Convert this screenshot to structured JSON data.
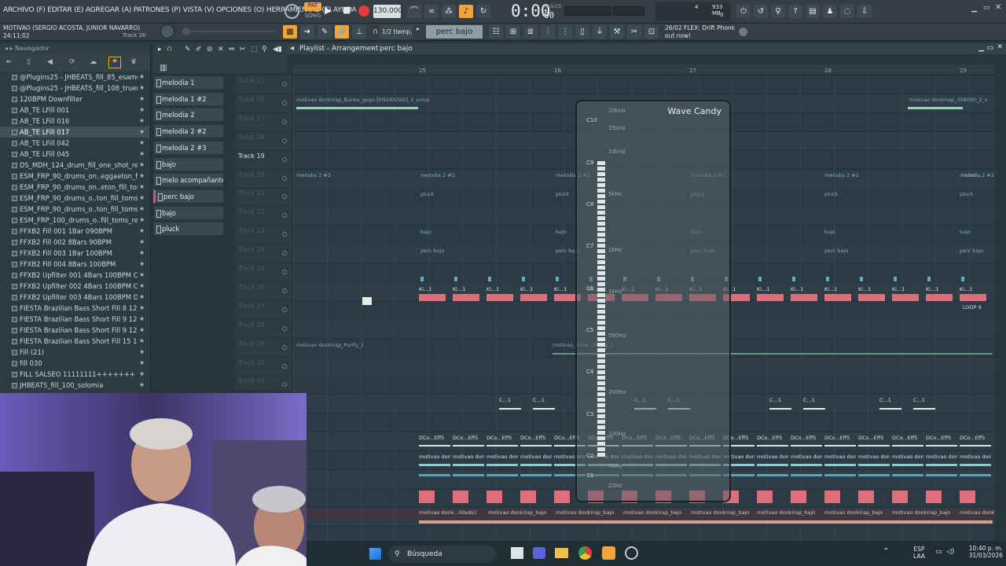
{
  "menu": "ARCHIVO (F) EDITAR (E) AGREGAR (A) PATRONES (P) VISTA (V) OPCIONES (O) HERRAMIENTAS (T) AYUDA",
  "transport": {
    "pat_label": "PAT",
    "song_label": "SONG",
    "tempo": "130.000",
    "time": "0:00",
    "time_unit": "00",
    "time_mode": "M:S:CS",
    "cpu_value": "4",
    "ram_value": "933 MB",
    "poly_value": "0"
  },
  "project": {
    "title": "MOTIVAO (SERGIO ACOSTA, JUNIOR NAVARRO)",
    "time": "24:11:02",
    "track": "Track 26"
  },
  "toolbar2": {
    "snap": "1/2 tiemp.",
    "pattern": "perc bajo",
    "news_date": "26/02",
    "news_text": "FLEX: Drift Phonk",
    "news_text2": "out now!"
  },
  "browser": {
    "title": "Navegador",
    "items": [
      {
        "label": "@Plugins25 - JHBEATS_fill_85_esamor",
        "star": "★"
      },
      {
        "label": "@Plugins25 - JHBEATS_fill_108_trueno",
        "star": "★"
      },
      {
        "label": "120BPM Downfilter",
        "star": "★"
      },
      {
        "label": "AB_TE LFill 001",
        "star": "★"
      },
      {
        "label": "AB_TE LFill 016",
        "star": "★"
      },
      {
        "label": "AB_TE LFill 017",
        "star": "★"
      },
      {
        "label": "AB_TE LFill 042",
        "star": "★"
      },
      {
        "label": "AB_TE LFill 045",
        "star": "★"
      },
      {
        "label": "DS_MDH_124_drum_fill_one_shot_reggae",
        "star": "★"
      },
      {
        "label": "ESM_FRP_90_drums_on..eggaeton_fill_swing",
        "star": "★"
      },
      {
        "label": "ESM_FRP_90_drums_on..eton_fill_toms_jack",
        "star": "★"
      },
      {
        "label": "ESM_FRP_90_drums_o..ton_fill_toms_proud",
        "star": "★"
      },
      {
        "label": "ESM_FRP_90_drums_o..ton_fill_toms_punch",
        "star": "★"
      },
      {
        "label": "ESM_FRP_100_drums_o..fill_toms_resonate",
        "star": "★"
      },
      {
        "label": "FFXB2 Fill 001 1Bar 090BPM",
        "star": "★"
      },
      {
        "label": "FFXB2 Fill 002 8Bars 90BPM",
        "star": "★"
      },
      {
        "label": "FFXB2 Fill 003 1Bar 100BPM",
        "star": "★"
      },
      {
        "label": "FFXB2 Fill 004 8Bars 100BPM",
        "star": "★"
      },
      {
        "label": "FFXB2 Upfilter 001 4Bars 100BPM C",
        "star": "★"
      },
      {
        "label": "FFXB2 Upfilter 002 4Bars 100BPM C#",
        "star": "★"
      },
      {
        "label": "FFXB2 Upfilter 003 4Bars 100BPM D",
        "star": "★"
      },
      {
        "label": "FIESTA Brazilian Bass Short Fill 8 126BPM",
        "star": "★"
      },
      {
        "label": "FIESTA Brazilian Bass Short Fill 9 125BPM",
        "star": "★"
      },
      {
        "label": "FIESTA Brazilian Bass Short Fill 9 125BPM",
        "star": "★"
      },
      {
        "label": "FIESTA Brazilian Bass Short Fill 15 125BPM",
        "star": "★"
      },
      {
        "label": "Fill  (21)",
        "star": "★"
      },
      {
        "label": "fill 030",
        "star": "★"
      },
      {
        "label": "FILL SALSEO 11111111+++++++",
        "star": "★"
      },
      {
        "label": "JHBEATS_fill_100_solomia",
        "star": "★"
      }
    ]
  },
  "playlist": {
    "title": "Playlist - Arrangement",
    "pattern": "perc bajo",
    "bars": [
      "25",
      "26",
      "27",
      "28",
      "29"
    ],
    "patterns": [
      "melodia 1",
      "melodia 1 #2",
      "melodia 2",
      "melodia 2 #2",
      "melodia 2 #3",
      "bajo",
      "melo acompañante",
      "perc bajo",
      "bajo",
      "pluck"
    ],
    "tracks": [
      "Track 15",
      "Track 16",
      "Track 17",
      "Track 18",
      "Track 19",
      "Track 20",
      "Track 21",
      "Track 22",
      "Track 23",
      "Track 24",
      "Track 25",
      "Track 26",
      "Track 27",
      "Track 28",
      "Track 29",
      "Track 30",
      "Track 31"
    ],
    "clips": {
      "vocals": "motivao donkirap_Bunke_gogo [ENVIDOSO]_2_vocals",
      "vocals_right": "motivao donkirap_308060_2_vocals",
      "melodia23": "melodia 2 #3",
      "melodia22": "melodia 2 #2",
      "melod": "melod...",
      "pluck": "pluck",
      "bajo": "bajo",
      "perc_bajo": "perc bajo",
      "kick": "Ki...1",
      "loop": "LOOP 9",
      "purify": "motivao donkirap_Purify_1",
      "purify2": "motivao_donk...Purify_1",
      "chord": "C...1",
      "fx": "DCo...Eff5",
      "claps": "motivao donk...[CLAPS L..DUNGEO Y ONE SHOT (1)_2",
      "bajo_bottom": "motivao donkirap_bajo",
      "bajo_first": "motivao donk...lidado]"
    }
  },
  "wavecandy": {
    "title": "Wave Candy",
    "freqs": [
      "20kHz",
      "15kHz",
      "10kHz",
      "5kHz",
      "2kHz",
      "1kHz",
      "500Hz",
      "200Hz",
      "100Hz",
      "50Hz",
      "20Hz"
    ],
    "notes": [
      "C10",
      "C9",
      "C8",
      "C7",
      "C6",
      "C5",
      "C4",
      "C3",
      "C2",
      "C1"
    ]
  },
  "taskbar": {
    "search": "Búsqueda",
    "lang1": "ESP",
    "lang2": "LAA",
    "time": "10:40 p. m.",
    "date": "31/03/2026"
  }
}
